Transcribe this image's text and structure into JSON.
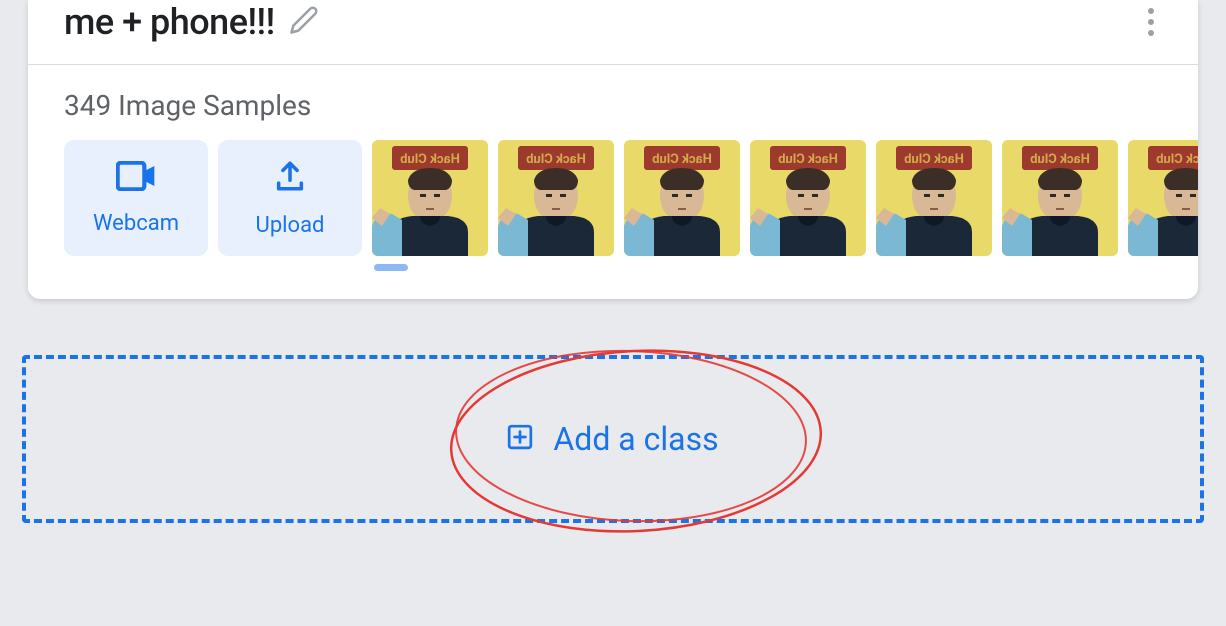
{
  "classCard": {
    "title": "me + phone!!!",
    "samplesCount": 349,
    "samplesLabel": "349 Image Samples",
    "webcamLabel": "Webcam",
    "uploadLabel": "Upload",
    "thumbnailCount": 7
  },
  "addClass": {
    "label": "Add a class"
  }
}
